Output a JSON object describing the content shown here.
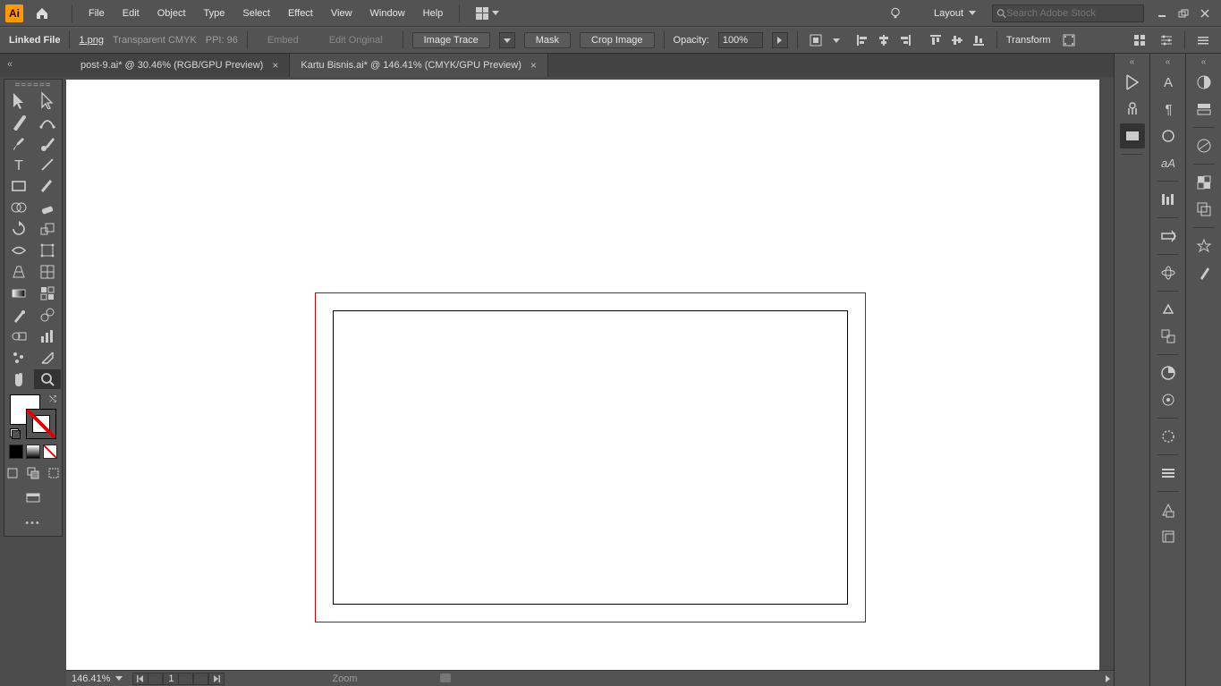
{
  "app": {
    "logo": "Ai"
  },
  "menu": [
    "File",
    "Edit",
    "Object",
    "Type",
    "Select",
    "Effect",
    "View",
    "Window",
    "Help"
  ],
  "workspace_selector": "Layout",
  "search_placeholder": "Search Adobe Stock",
  "options": {
    "selection_type": "Linked File",
    "filename": "1.png",
    "color_mode": "Transparent CMYK",
    "ppi": "PPI: 96",
    "embed": "Embed",
    "edit_original": "Edit Original",
    "image_trace": "Image Trace",
    "mask": "Mask",
    "crop": "Crop Image",
    "opacity_label": "Opacity:",
    "opacity_value": "100%",
    "transform": "Transform"
  },
  "tabs": [
    {
      "label": "post-9.ai* @ 30.46% (RGB/GPU Preview)",
      "active": false
    },
    {
      "label": "Kartu Bisnis.ai* @ 146.41% (CMYK/GPU Preview)",
      "active": true
    }
  ],
  "status": {
    "zoom": "146.41%",
    "artboard": "1",
    "zoom_label": "Zoom"
  },
  "tool_names": [
    "selection",
    "direct-selection",
    "pen",
    "curvature",
    "paintbrush",
    "blob-brush",
    "type",
    "line-segment",
    "rectangle",
    "brush",
    "shape-builder",
    "eraser",
    "rotate",
    "scale",
    "width",
    "free-transform",
    "perspective",
    "mesh",
    "gradient",
    "eyedropper-sample",
    "eyedropper",
    "measure",
    "blend",
    "column-graph",
    "symbol-sprayer",
    "slice",
    "hand",
    "zoom"
  ],
  "right_panels_a": [
    "properties",
    "libraries",
    "swatch"
  ],
  "right_panels_b": [
    "character",
    "glyphs",
    "paragraph",
    "opentype",
    "align",
    "links",
    "play",
    "artboards",
    "recolor",
    "appearance",
    "graphic-styles",
    "stroke-panel",
    "layers",
    "asset-export",
    "artboard-tool"
  ],
  "right_panels_c": [
    "color",
    "color-guide",
    "gradient-panel",
    "transparency",
    "pathfinder",
    "symbols",
    "brushes-panel"
  ]
}
